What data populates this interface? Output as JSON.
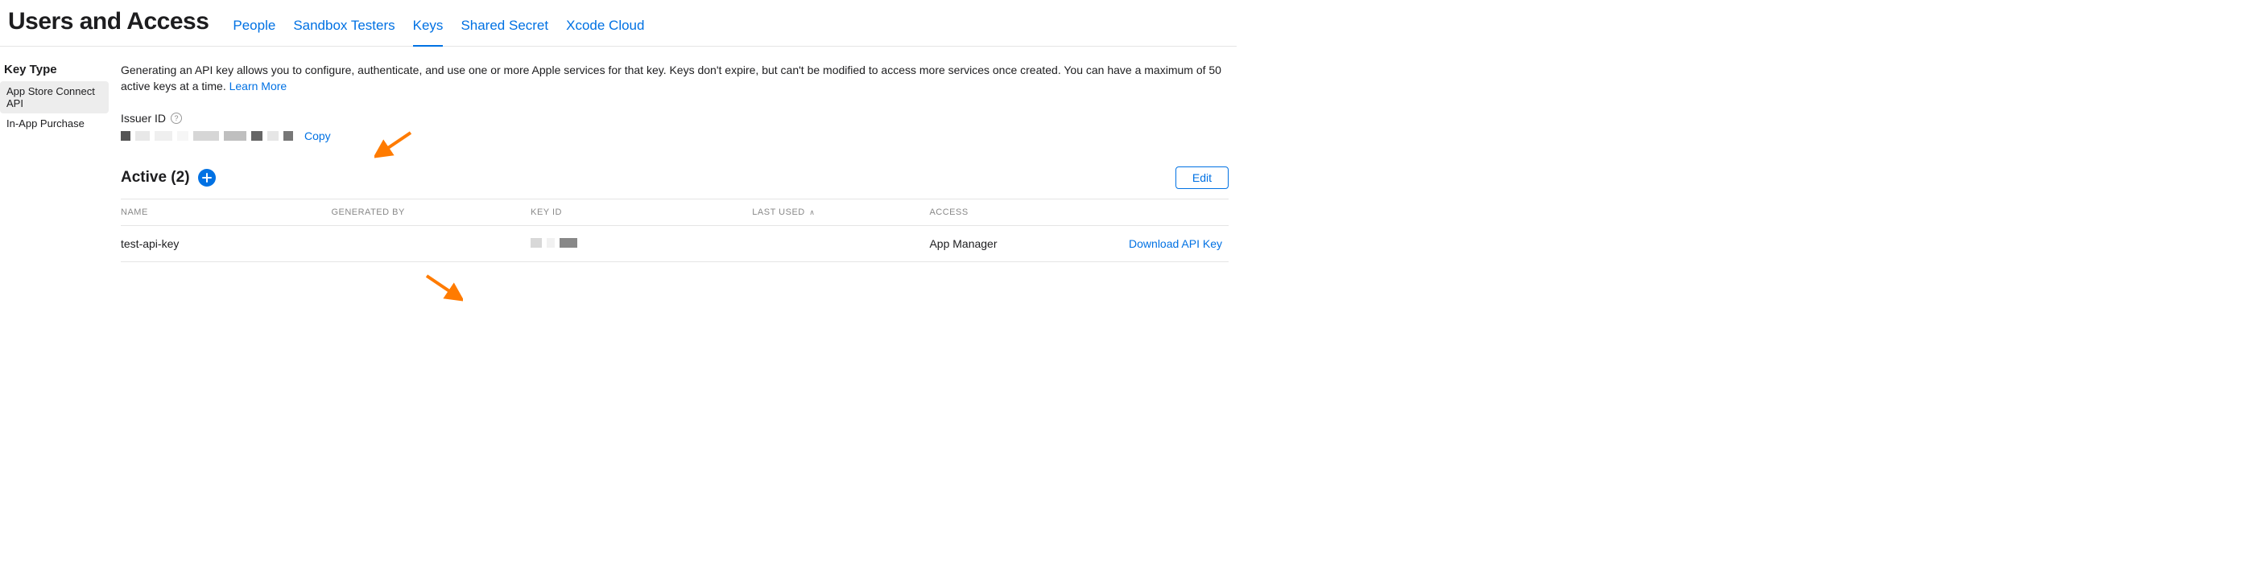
{
  "header": {
    "title": "Users and Access",
    "tabs": [
      {
        "label": "People",
        "active": false
      },
      {
        "label": "Sandbox Testers",
        "active": false
      },
      {
        "label": "Keys",
        "active": true
      },
      {
        "label": "Shared Secret",
        "active": false
      },
      {
        "label": "Xcode Cloud",
        "active": false
      }
    ]
  },
  "sidebar": {
    "title": "Key Type",
    "items": [
      {
        "label": "App Store Connect API",
        "selected": true
      },
      {
        "label": "In-App Purchase",
        "selected": false
      }
    ]
  },
  "intro": {
    "text": "Generating an API key allows you to configure, authenticate, and use one or more Apple services for that key. Keys don't expire, but can't be modified to access more services once created. You can have a maximum of 50 active keys at a time.",
    "learn_more": "Learn More"
  },
  "issuer": {
    "label": "Issuer ID",
    "copy": "Copy"
  },
  "active_section": {
    "title": "Active (2)",
    "edit": "Edit"
  },
  "table": {
    "headers": {
      "name": "NAME",
      "generated_by": "GENERATED BY",
      "key_id": "KEY ID",
      "last_used": "LAST USED",
      "access": "ACCESS"
    },
    "rows": [
      {
        "name": "test-api-key",
        "generated_by": "",
        "key_id": "",
        "last_used": "",
        "access": "App Manager",
        "download": "Download API Key"
      }
    ]
  }
}
